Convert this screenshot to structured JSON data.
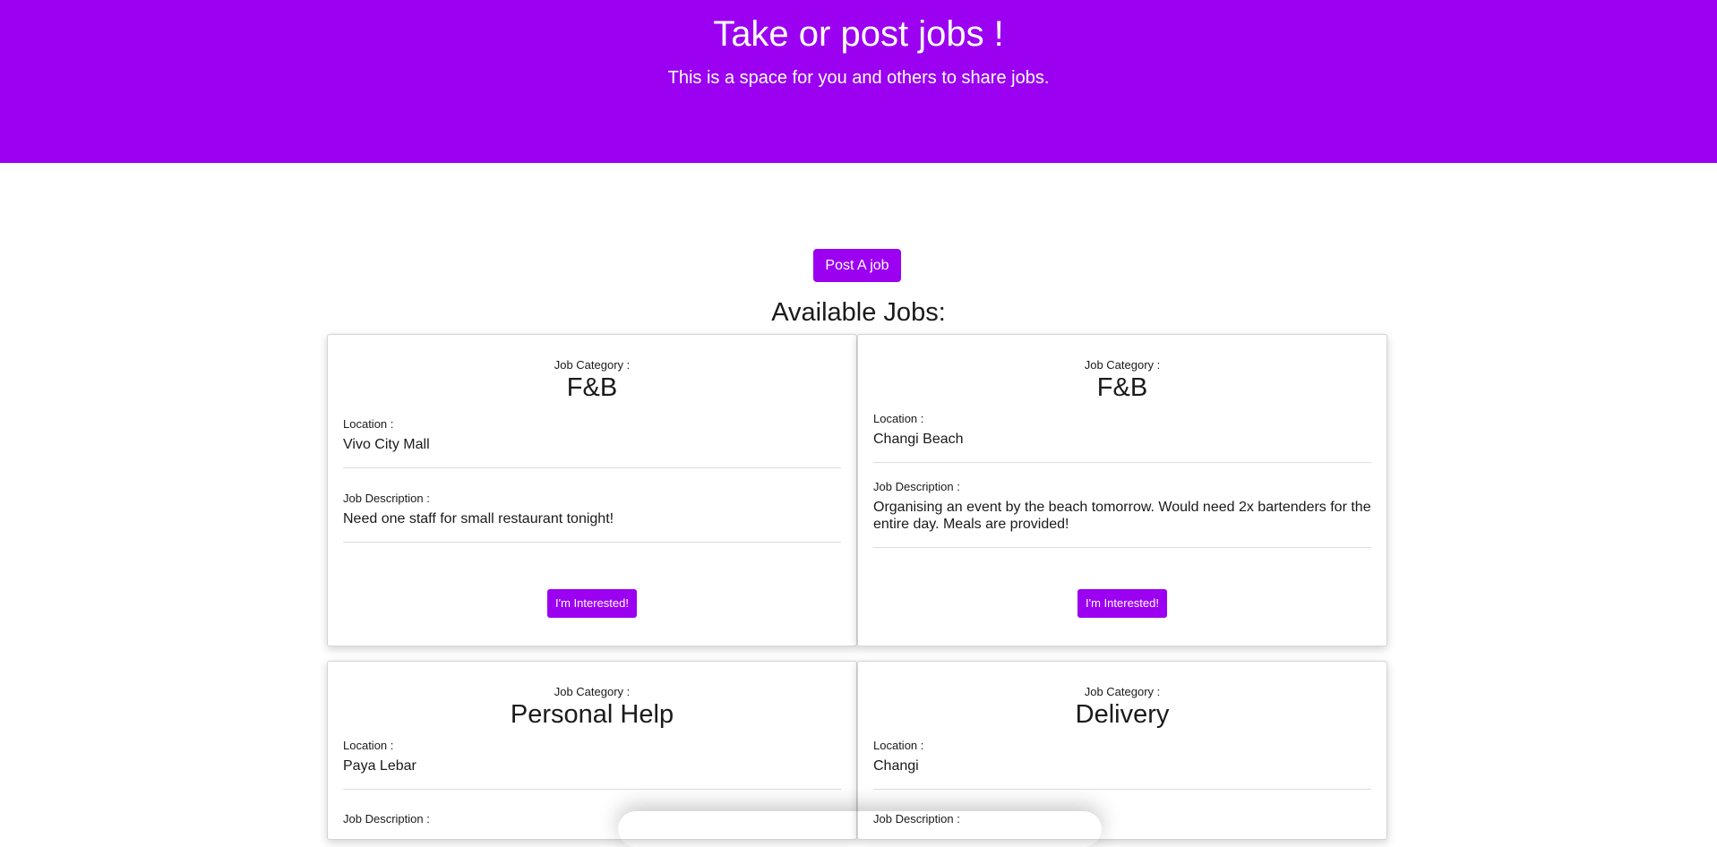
{
  "header": {
    "title": "Take or post jobs !",
    "subtitle": "This is a space for you and others to share jobs."
  },
  "actions": {
    "post_job_label": "Post A job"
  },
  "jobs_heading": "Available Jobs:",
  "labels": {
    "category": "Job Category :",
    "location": "Location :",
    "description": "Job Description :",
    "interested": "I'm Interested!"
  },
  "jobs": [
    {
      "category": "F&B",
      "location": "Vivo City Mall",
      "description": "Need one staff for small restaurant tonight!"
    },
    {
      "category": "F&B",
      "location": "Changi Beach",
      "description": "Organising an event by the beach tomorrow. Would need 2x bartenders for the entire day. Meals are provided!"
    },
    {
      "category": "Personal Help",
      "location": "Paya Lebar",
      "description": ""
    },
    {
      "category": "Delivery",
      "location": "Changi",
      "description": ""
    }
  ],
  "colors": {
    "accent": "#9b00f0"
  }
}
